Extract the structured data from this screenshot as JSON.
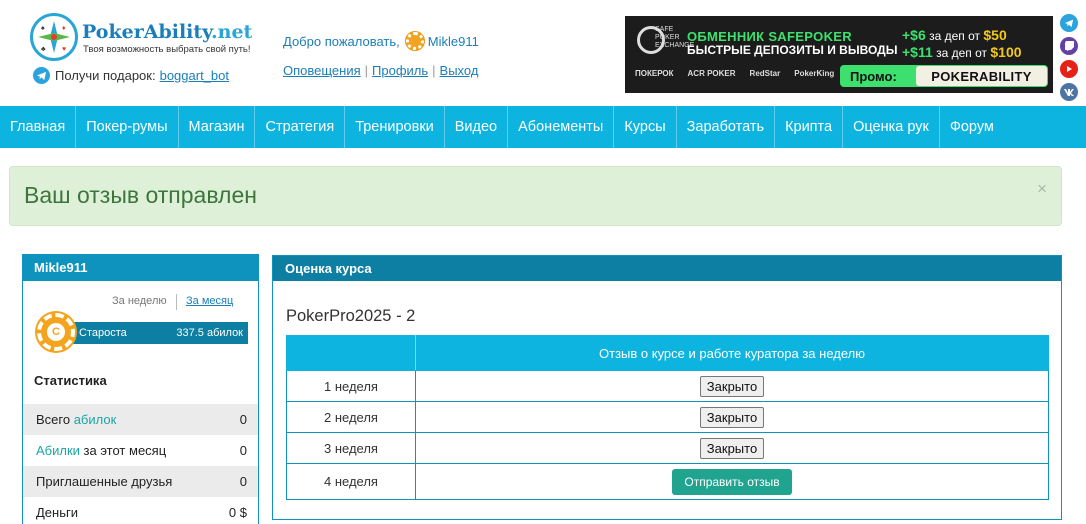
{
  "header": {
    "logo_name": "PokerAbility",
    "logo_tld": ".net",
    "slogan": "Твоя возможность выбрать свой путь!",
    "gift_text": "Получи подарок:",
    "gift_link": "boggart_bot",
    "welcome_text": "Добро пожаловать,",
    "username": "Mikle911",
    "links": [
      "Оповещения",
      "Профиль",
      "Выход"
    ]
  },
  "banner": {
    "logo_text": [
      "SAFE",
      "POKER",
      "EXCHANGE"
    ],
    "title1": "ОБМЕННИК SAFEPOKER",
    "title2": "БЫСТРЫЕ ДЕПОЗИТЫ И ВЫВОДЫ",
    "bonus1_amount": "+$6",
    "bonus1_text": "за деп от",
    "bonus1_min": "$50",
    "bonus2_amount": "+$11",
    "bonus2_text": "за деп от",
    "bonus2_min": "$100",
    "rooms": [
      "ПОКЕРОК",
      "ACR POKER",
      "RedStar",
      "PokerKing"
    ],
    "promo_label": "Промо:",
    "promo_code": "POKERABILITY"
  },
  "nav": {
    "items": [
      "Главная",
      "Покер-румы",
      "Магазин",
      "Стратегия",
      "Тренировки",
      "Видео",
      "Абонементы",
      "Курсы",
      "Заработать",
      "Крипта",
      "Оценка рук",
      "Форум"
    ]
  },
  "alert": {
    "text": "Ваш отзыв отправлен",
    "close": "×"
  },
  "sidebar": {
    "username": "Mikle911",
    "period_week": "За неделю",
    "period_month": "За месяц",
    "chip_letter": "С",
    "rank_name": "Староста",
    "rank_value": "337.5 абилок",
    "stats_title": "Статистика",
    "stats": [
      {
        "label_pre": "Всего ",
        "label_link": "абилок",
        "label_post": "",
        "value": "0"
      },
      {
        "label_pre": "",
        "label_link": "Абилки",
        "label_post": " за этот месяц",
        "value": "0"
      },
      {
        "label_pre": "Приглашенные друзья",
        "label_link": "",
        "label_post": "",
        "value": "0"
      },
      {
        "label_pre": "Деньги",
        "label_link": "",
        "label_post": "",
        "value": "0 $"
      }
    ]
  },
  "panel": {
    "title": "Оценка курса",
    "course": "PokerPro2025 - 2",
    "col_header": "Отзыв о курсе и работе куратора за неделю",
    "rows": [
      {
        "week": "1 неделя",
        "action": "Закрыто"
      },
      {
        "week": "2 неделя",
        "action": "Закрыто"
      },
      {
        "week": "3 неделя",
        "action": "Закрыто"
      },
      {
        "week": "4 неделя",
        "action": "Отправить отзыв"
      }
    ]
  },
  "colors": {
    "nav": "#0db4e0",
    "panel_head": "#0d7fa3",
    "alert_bg": "#dff0d8",
    "send_button": "#20a490"
  }
}
